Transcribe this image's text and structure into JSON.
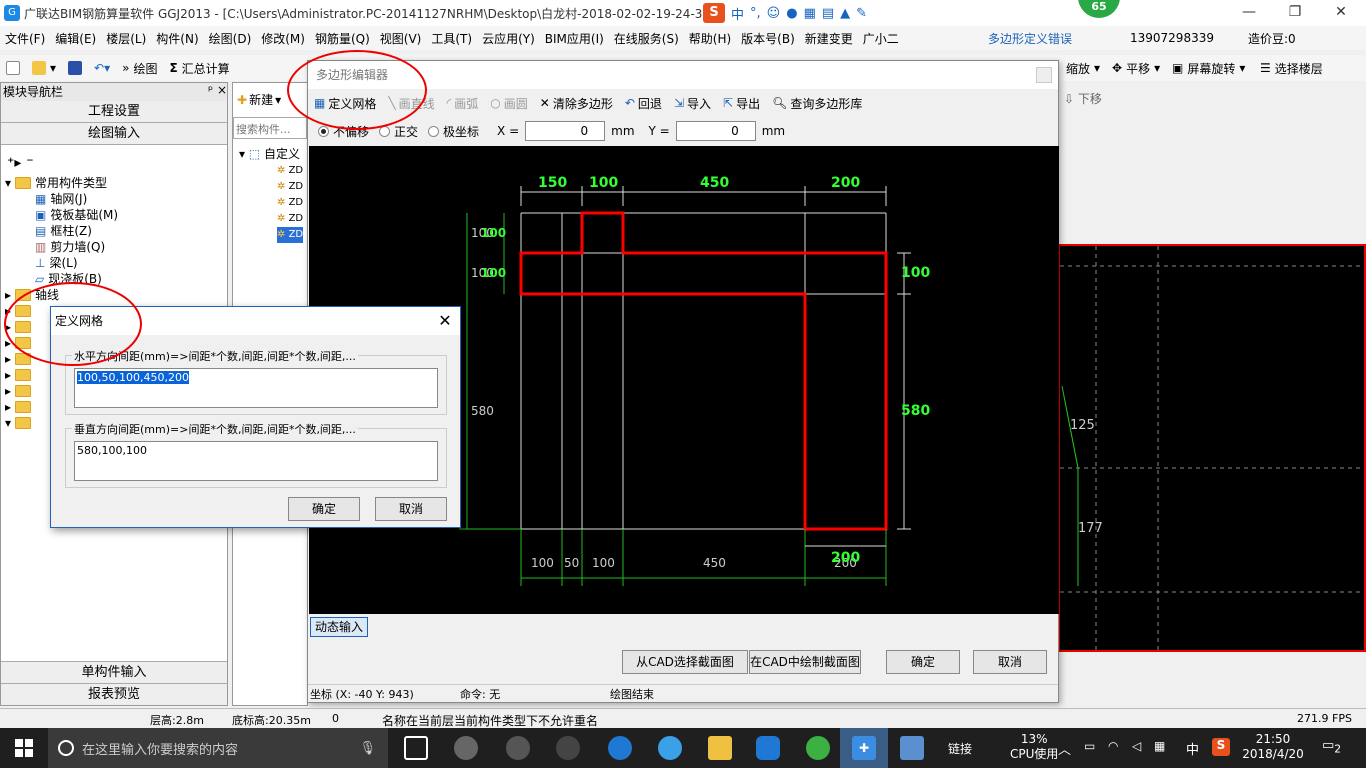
{
  "title": "广联达BIM钢筋算量软件 GGJ2013 - [C:\\Users\\Administrator.PC-20141127NRHM\\Desktop\\白龙村-2018-02-02-19-24-35",
  "badge": "65",
  "ime": {
    "lang": "中"
  },
  "menu": [
    "文件(F)",
    "编辑(E)",
    "楼层(L)",
    "构件(N)",
    "绘图(D)",
    "修改(M)",
    "钢筋量(Q)",
    "视图(V)",
    "工具(T)",
    "云应用(Y)",
    "BIM应用(I)",
    "在线服务(S)",
    "帮助(H)",
    "版本号(B)",
    "新建变更",
    "广小二"
  ],
  "menu_err": "多边形定义错误",
  "phone": "13907298339",
  "price": "造价豆:0",
  "toolbar": {
    "draw": "绘图",
    "sum": "汇总计算",
    "zoom": "缩放",
    "pan": "平移",
    "rotate": "屏幕旋转",
    "select_floor": "选择楼层",
    "down": "下移"
  },
  "left": {
    "title": "模块导航栏",
    "proj": "工程设置",
    "draw_input": "绘图输入",
    "tree": [
      "常用构件类型",
      "轴网(J)",
      "筏板基础(M)",
      "框柱(Z)",
      "剪力墙(Q)",
      "梁(L)",
      "现浇板(B)",
      "轴线"
    ],
    "single": "单构件输入",
    "report": "报表预览"
  },
  "mid": {
    "new": "新建",
    "search_placeholder": "搜索构件...",
    "root": "自定义",
    "items": [
      "ZD",
      "ZD",
      "ZD",
      "ZD",
      "ZD"
    ]
  },
  "poly": {
    "title": "多边形编辑器",
    "tools": {
      "grid": "定义网格",
      "line": "画直线",
      "arc": "画弧",
      "circle": "画圆",
      "clear": "清除多边形",
      "undo": "回退",
      "import": "导入",
      "export": "导出",
      "query": "查询多边形库"
    },
    "opts": {
      "no_offset": "不偏移",
      "ortho": "正交",
      "polar": "极坐标",
      "x_label": "X =",
      "x_val": "0",
      "y_label": "Y =",
      "y_val": "0",
      "unit": "mm"
    },
    "dims_top": [
      "150",
      "100",
      "450",
      "200"
    ],
    "dims_bottom": [
      "100",
      "50",
      "100",
      "450",
      "200"
    ],
    "dims_bottom_green": "200",
    "dims_left": [
      "100",
      "100",
      "580"
    ],
    "dims_left_green": [
      "100",
      "100"
    ],
    "dims_right": [
      "100",
      "580"
    ],
    "dyn_input": "动态输入",
    "btn_cad_select": "从CAD选择截面图",
    "btn_cad_draw": "在CAD中绘制截面图",
    "btn_ok": "确定",
    "btn_cancel": "取消",
    "status_coord": "坐标 (X: -40 Y: 943)",
    "status_cmd": "命令: 无",
    "status_msg": "绘图结束"
  },
  "grid_dlg": {
    "title": "定义网格",
    "h_label": "水平方向间距(mm)=>间距*个数,间距,间距*个数,间距,...",
    "h_value": "100,50,100,450,200",
    "v_label": "垂直方向间距(mm)=>间距*个数,间距,间距*个数,间距,...",
    "v_value": "580,100,100",
    "ok": "确定",
    "cancel": "取消"
  },
  "right_canvas": {
    "label1": "125",
    "label2": "177"
  },
  "status": {
    "floor_h": "层高:2.8m",
    "base_h": "底标高:20.35m",
    "zero": "0",
    "msg": "名称在当前层当前构件类型下不允许重名",
    "fps": "271.9 FPS"
  },
  "taskbar": {
    "search": "在这里输入你要搜索的内容",
    "link": "链接",
    "cpu_pct": "13%",
    "cpu_label": "CPU使用",
    "ime": "中",
    "time": "21:50",
    "date": "2018/4/20",
    "notif": "2"
  }
}
